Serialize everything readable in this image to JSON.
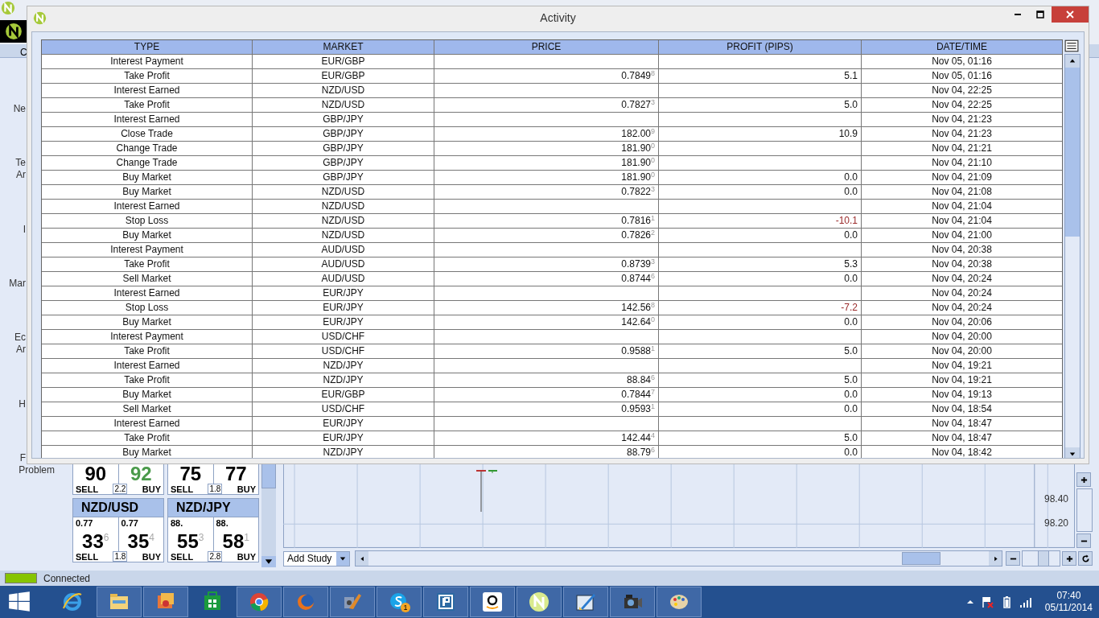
{
  "app": {
    "tab_fragment": "C",
    "sidebar_groups": [
      {
        "lines": [
          "Ne"
        ]
      },
      {
        "lines": [
          "Te",
          "Ar"
        ]
      },
      {
        "lines": [
          "I"
        ]
      },
      {
        "lines": [
          "Mar"
        ]
      },
      {
        "lines": [
          "Ec",
          "Ar"
        ]
      },
      {
        "lines": [
          "H"
        ]
      },
      {
        "lines": [
          "F",
          "Problem"
        ]
      }
    ]
  },
  "tickers": [
    {
      "sell": {
        "big": "90",
        "up": false
      },
      "buy": {
        "big": "92",
        "up": true
      },
      "spread": "2.2",
      "sell_label": "SELL",
      "buy_label": "BUY"
    },
    {
      "sell": {
        "big": "75",
        "up": false
      },
      "buy": {
        "big": "77",
        "up": false
      },
      "spread": "1.8",
      "sell_label": "SELL",
      "buy_label": "BUY"
    },
    {
      "pair": "NZD/USD",
      "sell": {
        "prefix": "0.77",
        "big": "33",
        "pip": "6",
        "up": false
      },
      "buy": {
        "prefix": "0.77",
        "big": "35",
        "pip": "4",
        "up": false
      },
      "spread": "1.8",
      "sell_label": "SELL",
      "buy_label": "BUY"
    },
    {
      "pair": "NZD/JPY",
      "sell": {
        "prefix": "88.",
        "big": "55",
        "pip": "3",
        "up": false
      },
      "buy": {
        "prefix": "88.",
        "big": "58",
        "pip": "1",
        "up": false
      },
      "spread": "2.8",
      "sell_label": "SELL",
      "buy_label": "BUY"
    }
  ],
  "chart": {
    "y_labels": [
      "98.40",
      "98.20"
    ],
    "add_study": "Add Study",
    "zoom": {
      "level": 0.55
    }
  },
  "status": {
    "text": "Connected",
    "connected": true
  },
  "dialog": {
    "title": "Activity",
    "columns": [
      "TYPE",
      "MARKET",
      "PRICE",
      "PROFIT (PIPS)",
      "DATE/TIME"
    ],
    "rows": [
      {
        "type": "Interest Payment",
        "market": "EUR/GBP",
        "datetime": "Nov 05, 01:16"
      },
      {
        "type": "Take Profit",
        "market": "EUR/GBP",
        "price": "0.7849$^{8}$",
        "profit": {
          "value": "5.1",
          "loss": false
        },
        "datetime": "Nov 05, 01:16"
      },
      {
        "type": "Interest Earned",
        "market": "NZD/USD",
        "datetime": "Nov 04, 22:25"
      },
      {
        "type": "Take Profit",
        "market": "NZD/USD",
        "price": "0.7827$^{3}$",
        "profit": {
          "value": "5.0",
          "loss": false
        },
        "datetime": "Nov 04, 22:25"
      },
      {
        "type": "Interest Earned",
        "market": "GBP/JPY",
        "datetime": "Nov 04, 21:23"
      },
      {
        "type": "Close Trade",
        "market": "GBP/JPY",
        "price": "182.00$^{9}$",
        "profit": {
          "value": "10.9",
          "loss": false
        },
        "datetime": "Nov 04, 21:23"
      },
      {
        "type": "Change Trade",
        "market": "GBP/JPY",
        "price": "181.90$^{0}$",
        "datetime": "Nov 04, 21:21"
      },
      {
        "type": "Change Trade",
        "market": "GBP/JPY",
        "price": "181.90$^{0}$",
        "datetime": "Nov 04, 21:10"
      },
      {
        "type": "Buy Market",
        "market": "GBP/JPY",
        "price": "181.90$^{0}$",
        "profit": {
          "value": "0.0",
          "loss": false
        },
        "datetime": "Nov 04, 21:09"
      },
      {
        "type": "Buy Market",
        "market": "NZD/USD",
        "price": "0.7822$^{3}$",
        "profit": {
          "value": "0.0",
          "loss": false
        },
        "datetime": "Nov 04, 21:08"
      },
      {
        "type": "Interest Earned",
        "market": "NZD/USD",
        "datetime": "Nov 04, 21:04"
      },
      {
        "type": "Stop Loss",
        "market": "NZD/USD",
        "price": "0.7816$^{1}$",
        "profit": {
          "value": "-10.1",
          "loss": true
        },
        "datetime": "Nov 04, 21:04"
      },
      {
        "type": "Buy Market",
        "market": "NZD/USD",
        "price": "0.7826$^{2}$",
        "profit": {
          "value": "0.0",
          "loss": false
        },
        "datetime": "Nov 04, 21:00"
      },
      {
        "type": "Interest Payment",
        "market": "AUD/USD",
        "datetime": "Nov 04, 20:38"
      },
      {
        "type": "Take Profit",
        "market": "AUD/USD",
        "price": "0.8739$^{3}$",
        "profit": {
          "value": "5.3",
          "loss": false
        },
        "datetime": "Nov 04, 20:38"
      },
      {
        "type": "Sell Market",
        "market": "AUD/USD",
        "price": "0.8744$^{6}$",
        "profit": {
          "value": "0.0",
          "loss": false
        },
        "datetime": "Nov 04, 20:24"
      },
      {
        "type": "Interest Earned",
        "market": "EUR/JPY",
        "datetime": "Nov 04, 20:24"
      },
      {
        "type": "Stop Loss",
        "market": "EUR/JPY",
        "price": "142.56$^{8}$",
        "profit": {
          "value": "-7.2",
          "loss": true
        },
        "datetime": "Nov 04, 20:24"
      },
      {
        "type": "Buy Market",
        "market": "EUR/JPY",
        "price": "142.64$^{0}$",
        "profit": {
          "value": "0.0",
          "loss": false
        },
        "datetime": "Nov 04, 20:06"
      },
      {
        "type": "Interest Payment",
        "market": "USD/CHF",
        "datetime": "Nov 04, 20:00"
      },
      {
        "type": "Take Profit",
        "market": "USD/CHF",
        "price": "0.9588$^{1}$",
        "profit": {
          "value": "5.0",
          "loss": false
        },
        "datetime": "Nov 04, 20:00"
      },
      {
        "type": "Interest Earned",
        "market": "NZD/JPY",
        "datetime": "Nov 04, 19:21"
      },
      {
        "type": "Take Profit",
        "market": "NZD/JPY",
        "price": "88.84$^{6}$",
        "profit": {
          "value": "5.0",
          "loss": false
        },
        "datetime": "Nov 04, 19:21"
      },
      {
        "type": "Buy Market",
        "market": "EUR/GBP",
        "price": "0.7844$^{7}$",
        "profit": {
          "value": "0.0",
          "loss": false
        },
        "datetime": "Nov 04, 19:13"
      },
      {
        "type": "Sell Market",
        "market": "USD/CHF",
        "price": "0.9593$^{1}$",
        "profit": {
          "value": "0.0",
          "loss": false
        },
        "datetime": "Nov 04, 18:54"
      },
      {
        "type": "Interest Earned",
        "market": "EUR/JPY",
        "datetime": "Nov 04, 18:47"
      },
      {
        "type": "Take Profit",
        "market": "EUR/JPY",
        "price": "142.44$^{4}$",
        "profit": {
          "value": "5.0",
          "loss": false
        },
        "datetime": "Nov 04, 18:47"
      },
      {
        "type": "Buy Market",
        "market": "NZD/JPY",
        "price": "88.79$^{6}$",
        "profit": {
          "value": "0.0",
          "loss": false
        },
        "datetime": "Nov 04, 18:42"
      }
    ]
  },
  "taskbar": {
    "apps": [
      {
        "running": false
      },
      {
        "running": true
      },
      {
        "running": true
      },
      {
        "running": false
      },
      {
        "running": true
      },
      {
        "running": true
      },
      {
        "running": true
      },
      {
        "running": true
      },
      {
        "running": true
      },
      {
        "running": true
      },
      {
        "running": true
      },
      {
        "running": true
      },
      {
        "running": true
      },
      {
        "running": true
      }
    ],
    "skype_badge": "1",
    "time": "07:40",
    "date": "05/11/2014"
  }
}
